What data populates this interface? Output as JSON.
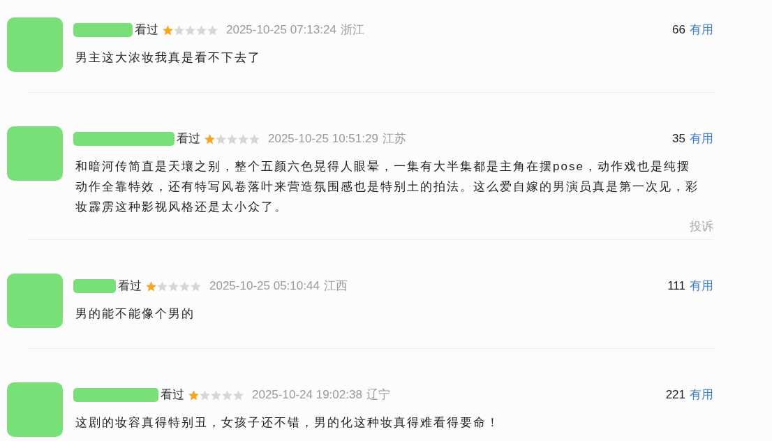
{
  "reviews": [
    {
      "status": "看过",
      "stars": 1,
      "time": "2025-10-25 07:13:24",
      "location": "浙江",
      "useful_count": "66",
      "useful_label": "有用",
      "text": "男主这大浓妆我真是看不下去了"
    },
    {
      "status": "看过",
      "stars": 1,
      "time": "2025-10-25 10:51:29",
      "location": "江苏",
      "useful_count": "35",
      "useful_label": "有用",
      "text": "和暗河传简直是天壤之别，整个五颜六色晃得人眼晕，一集有大半集都是主角在摆pose，动作戏也是纯摆动作全靠特效，还有特写风卷落叶来营造氛围感也是特别土的拍法。这么爱自嫁的男演员真是第一次见，彩妆霹雳这种影视风格还是太小众了。",
      "report": "投诉"
    },
    {
      "status": "看过",
      "stars": 1,
      "time": "2025-10-25 05:10:44",
      "location": "江西",
      "useful_count": "111",
      "useful_label": "有用",
      "text": "男的能不能像个男的"
    },
    {
      "status": "看过",
      "stars": 1,
      "time": "2025-10-24 19:02:38",
      "location": "辽宁",
      "useful_count": "221",
      "useful_label": "有用",
      "text": "这剧的妆容真得特别丑，女孩子还不错，男的化这种妆真得难看得要命！"
    }
  ]
}
